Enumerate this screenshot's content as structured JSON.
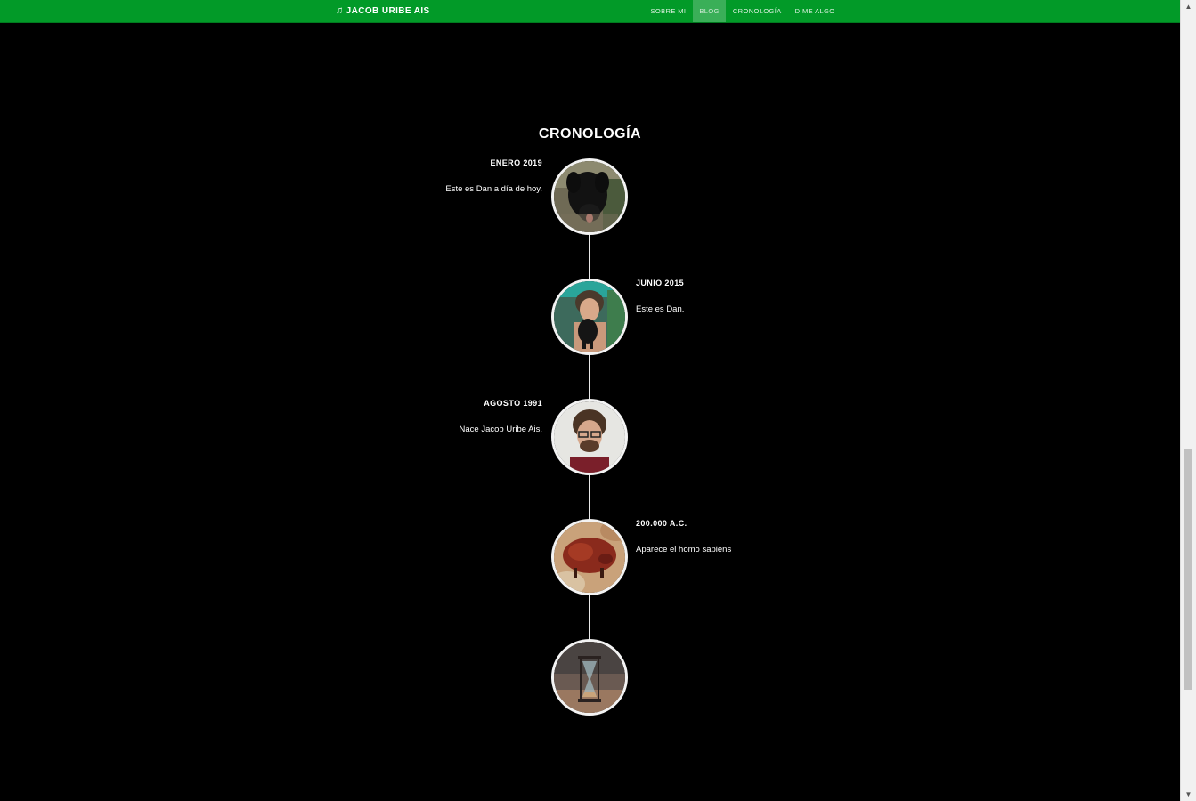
{
  "header": {
    "brand": "JACOB URIBE AIS",
    "brand_icon": "music-note-icon",
    "nav": [
      {
        "label": "SOBRE MI",
        "active": false
      },
      {
        "label": "BLOG",
        "active": true
      },
      {
        "label": "CRONOLOGÍA",
        "active": false
      },
      {
        "label": "DIME ALGO",
        "active": false
      }
    ],
    "colors": {
      "bar": "#029a28",
      "active": "#3aaf58"
    }
  },
  "timeline": {
    "title": "CRONOLOGÍA",
    "items": [
      {
        "date": "ENERO 2019",
        "text": "Este es Dan a día de hoy.",
        "image": "black-dog-photo"
      },
      {
        "date": "JUNIO 2015",
        "text": "Este es Dan.",
        "image": "person-holding-puppy-photo"
      },
      {
        "date": "AGOSTO 1991",
        "text": "Nace Jacob Uribe Ais.",
        "image": "portrait-man-glasses-photo"
      },
      {
        "date": "200.000 A.C.",
        "text": "Aparece el homo sapiens",
        "image": "cave-painting-bison-photo"
      },
      {
        "date": "",
        "text": "",
        "image": "hourglass-photo"
      }
    ]
  }
}
